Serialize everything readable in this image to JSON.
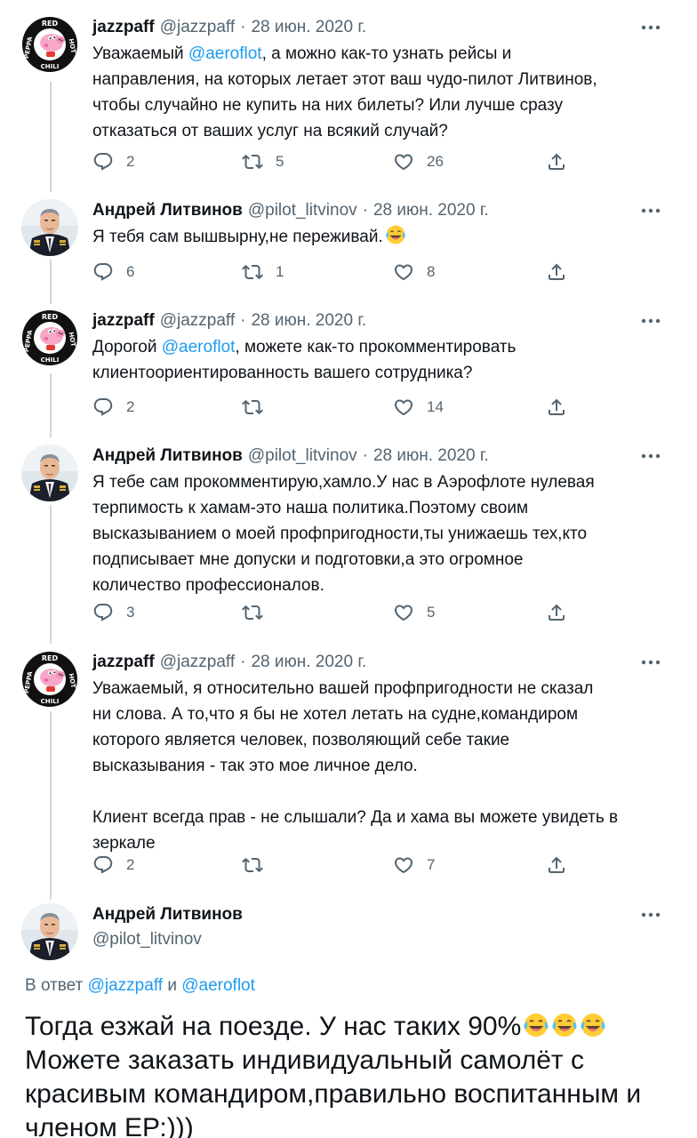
{
  "tweets": [
    {
      "name": "jazzpaff",
      "handle": "@jazzpaff",
      "sep": "·",
      "date": "28 июн. 2020 г.",
      "avatar_icon": "peppa-red-hot-chili-avatar",
      "text_before": "Уважаемый ",
      "mention": "@aeroflot",
      "text_after": ", а можно как-то узнать рейсы и\nнаправления, на которых летает этот ваш чудо-пилот Литвинов,\nчтобы случайно не купить на них билеты? Или лучше сразу\nотказаться от ваших услуг на всякий случай?",
      "replies": "2",
      "retweets": "5",
      "likes": "26"
    },
    {
      "name": "Андрей Литвинов",
      "handle": "@pilot_litvinov",
      "sep": "·",
      "date": "28 июн. 2020 г.",
      "avatar_icon": "pilot-portrait-avatar",
      "text": "Я тебя сам вышвырну,не переживай.",
      "emoji": "laughing-tears-emoji",
      "replies": "6",
      "retweets": "1",
      "likes": "8"
    },
    {
      "name": "jazzpaff",
      "handle": "@jazzpaff",
      "sep": "·",
      "date": "28 июн. 2020 г.",
      "avatar_icon": "peppa-red-hot-chili-avatar",
      "text_before": "Дорогой ",
      "mention": "@aeroflot",
      "text_after": ", можете как-то прокомментировать\nклиентоориентированность вашего сотрудника?",
      "replies": "2",
      "retweets": "",
      "likes": "14"
    },
    {
      "name": "Андрей Литвинов",
      "handle": "@pilot_litvinov",
      "sep": "·",
      "date": "28 июн. 2020 г.",
      "avatar_icon": "pilot-portrait-avatar",
      "text": "Я тебе сам прокомментирую,хамло.У нас в Аэрофлоте нулевая\nтерпимость к хамам-это наша политика.Поэтому своим\nвысказыванием о моей профпригодности,ты унижаешь тех,кто\nподписывает мне допуски и подготовки,а это огромное\nколичество профессионалов.",
      "replies": "3",
      "retweets": "",
      "likes": "5"
    },
    {
      "name": "jazzpaff",
      "handle": "@jazzpaff",
      "sep": "·",
      "date": "28 июн. 2020 г.",
      "avatar_icon": "peppa-red-hot-chili-avatar",
      "text": "Уважаемый, я относительно вашей профпригодности не сказал\nни слова. А то,что я бы не хотел летать на судне,командиром\nкоторого является человек, позволяющий себе такие\nвысказывания - так это мое личное дело.\n\nКлиент всегда прав - не слышали? Да и хама вы можете увидеть в\nзеркале",
      "replies": "2",
      "retweets": "",
      "likes": "7"
    }
  ],
  "main": {
    "name": "Андрей Литвинов",
    "handle": "@pilot_litvinov",
    "reply_prefix": "В ответ",
    "reply_user1": "@jazzpaff",
    "reply_and": "и",
    "reply_user2": "@aeroflot",
    "text_line1": "Тогда езжай на поезде. У нас таких 90%",
    "text_rest": "Можете заказать индивидуальный самолёт с\nкрасивым командиром,правильно воспитанным и\nчленом ЕР:)))",
    "emoji": "laughing-tears-emoji"
  },
  "colors": {
    "accent": "#1d9bf0",
    "secondary_text": "#536471",
    "thread_line": "#cfd9de"
  }
}
